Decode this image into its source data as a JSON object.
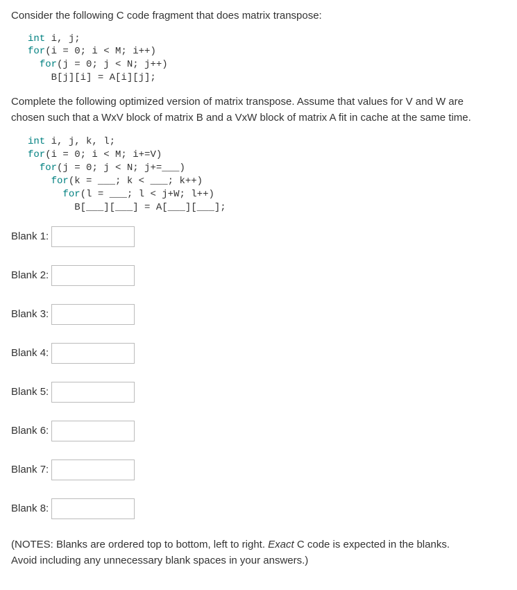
{
  "intro": "Consider the following C code fragment that does matrix transpose:",
  "code1": {
    "l1_decl": "int",
    "l1_rest": " i, j;",
    "l2_for": "for",
    "l2_rest": "(i = 0; i < M; i++)",
    "l3_for": "for",
    "l3_rest": "(j = 0; j < N; j++)",
    "l4": "B[j][i] = A[i][j];"
  },
  "para2a": "Complete the following optimized version of matrix transpose.  Assume that values for V and W are",
  "para2b": "chosen such that a WxV block of matrix B and a VxW block of matrix A fit in cache at the same time.",
  "code2": {
    "l1_decl": "int",
    "l1_rest": " i, j, k, l;",
    "l2_for": "for",
    "l2_rest": "(i = 0; i < M; i+=V)",
    "l3_for": "for",
    "l3_rest": "(j = 0; j < N; j+=___)",
    "l4_for": "for",
    "l4_rest": "(k = ___; k < ___; k++)",
    "l5_for": "for",
    "l5_rest": "(l = ___; l < j+W; l++)",
    "l6": "B[___][___] = A[___][___];"
  },
  "blanks": [
    {
      "label": "Blank 1:"
    },
    {
      "label": "Blank 2:"
    },
    {
      "label": "Blank 3:"
    },
    {
      "label": "Blank 4:"
    },
    {
      "label": "Blank 5:"
    },
    {
      "label": "Blank 6:"
    },
    {
      "label": "Blank 7:"
    },
    {
      "label": "Blank 8:"
    }
  ],
  "notes_prefix": "(NOTES: Blanks are ordered top to bottom, left to right.  ",
  "notes_italic": "Exact",
  "notes_mid": " C code is expected in the blanks.",
  "notes_line2": " Avoid including any unnecessary blank spaces in your answers.)"
}
